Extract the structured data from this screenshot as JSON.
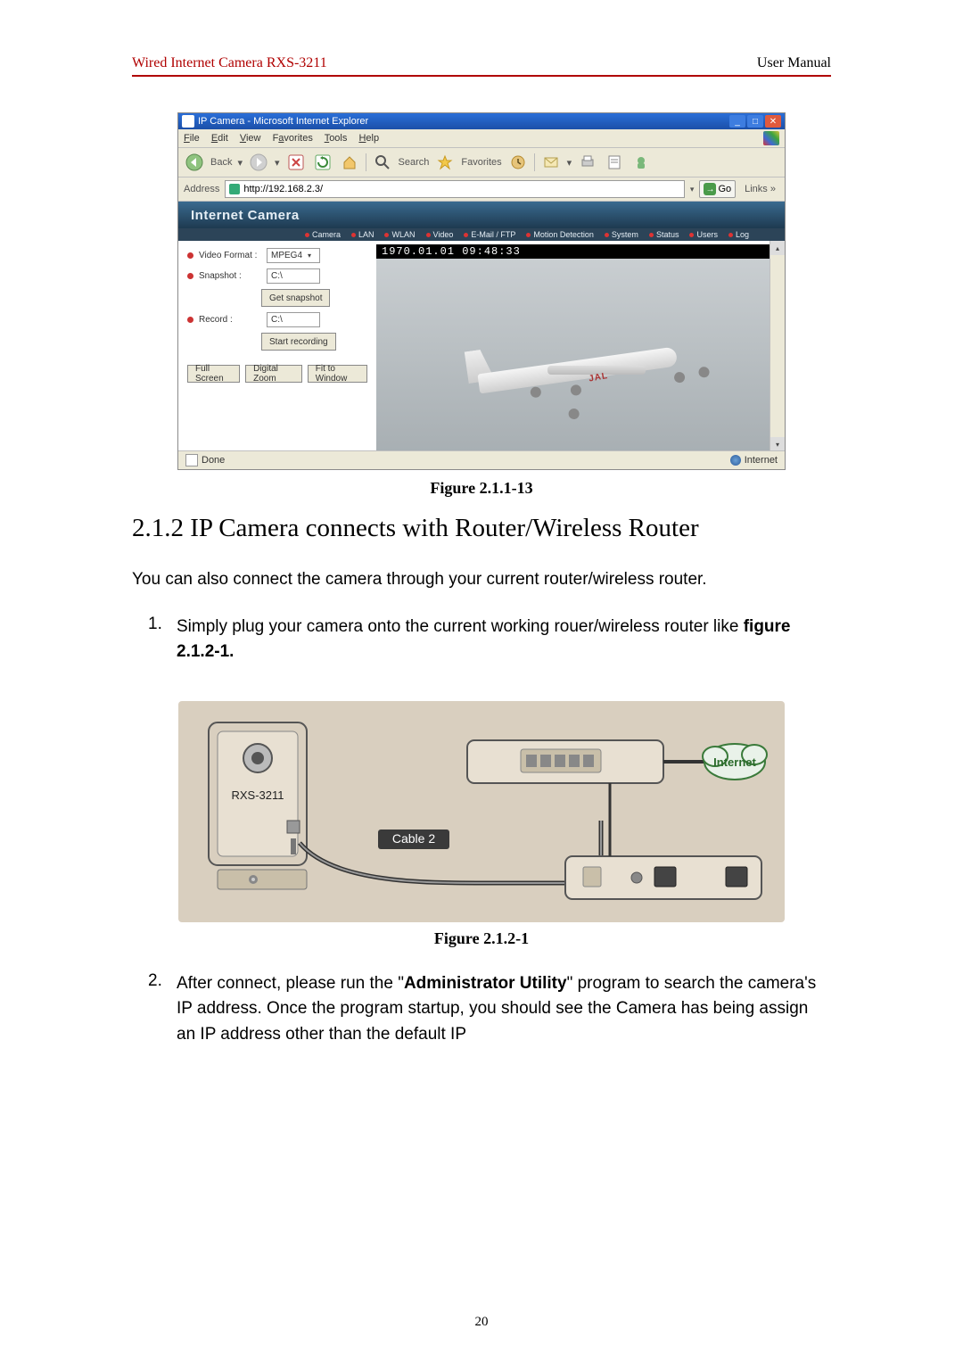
{
  "header": {
    "left": "Wired Internet Camera RXS-3211",
    "right": "User Manual"
  },
  "screenshot": {
    "window_title": "IP Camera - Microsoft Internet Explorer",
    "menubar": {
      "file": "File",
      "edit": "Edit",
      "view": "View",
      "favorites": "Favorites",
      "tools": "Tools",
      "help": "Help"
    },
    "toolbar": {
      "back": "Back",
      "search": "Search",
      "favorites": "Favorites"
    },
    "address_label": "Address",
    "address_value": "http://192.168.2.3/",
    "go": "Go",
    "links": "Links",
    "banner": "Internet Camera",
    "tabs": [
      "Camera",
      "LAN",
      "WLAN",
      "Video",
      "E-Mail / FTP",
      "Motion Detection",
      "System",
      "Status",
      "Users",
      "Log"
    ],
    "panel": {
      "video_format_label": "Video Format :",
      "video_format_value": "MPEG4",
      "snapshot_label": "Snapshot :",
      "snapshot_value": "C:\\",
      "get_snapshot": "Get snapshot",
      "record_label": "Record :",
      "record_value": "C:\\",
      "start_recording": "Start recording",
      "full_screen": "Full Screen",
      "digital_zoom": "Digital Zoom",
      "fit_to_window": "Fit to Window"
    },
    "timestamp": "1970.01.01 09:48:33",
    "plane_text": "JAL",
    "status_done": "Done",
    "status_zone": "Internet"
  },
  "caption1": "Figure 2.1.1-13",
  "section_title": "2.1.2 IP Camera connects with Router/Wireless Router",
  "intro": "You can also connect the camera through your current router/wireless router.",
  "step1_num": "1.",
  "step1_text_a": "Simply plug your camera onto the current working rouer/wireless router like ",
  "step1_text_b": "figure 2.1.2-1.",
  "diagram": {
    "camera_label": "RXS-3211",
    "cable_label": "Cable 2",
    "internet_label": "Internet"
  },
  "caption2": "Figure 2.1.2-1",
  "step2_num": "2.",
  "step2_a": "After connect, please run the \"",
  "step2_b": "Administrator Utility",
  "step2_c": "\" program to search the camera's IP address. Once the program startup, you should see the Camera has being assign an IP address other than the default IP",
  "page_number": "20"
}
